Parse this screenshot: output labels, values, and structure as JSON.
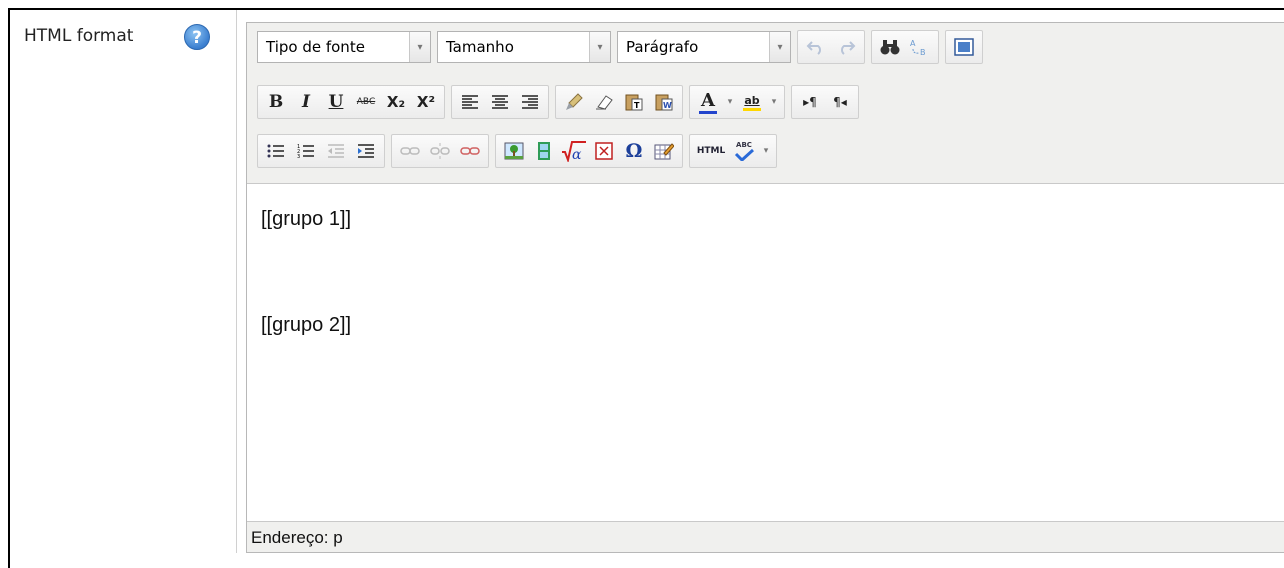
{
  "field": {
    "label": "HTML format",
    "help_icon": "?"
  },
  "toolbar": {
    "font_select": "Tipo de fonte",
    "size_select": "Tamanho",
    "format_select": "Parágrafo",
    "bold": "B",
    "italic": "I",
    "underline": "U",
    "strikethrough": "ABC",
    "subscript": "X₂",
    "superscript": "X²",
    "text_color": "A",
    "highlight": "ab",
    "ltr": "▸¶",
    "rtl": "¶◂",
    "html_source": "HTML",
    "spellcheck": "ABC",
    "omega": "Ω",
    "dropdown_glyph": "▾"
  },
  "content": {
    "paragraphs": [
      "[[grupo 1]]",
      "[[grupo 2]]"
    ]
  },
  "status": {
    "path": "Endereço: p"
  },
  "colors": {
    "toolbar_bg": "#f0f0ee",
    "help_icon": "#3b7fd0",
    "text_color_line": "#2244cc",
    "highlight_line": "#ffd700"
  }
}
